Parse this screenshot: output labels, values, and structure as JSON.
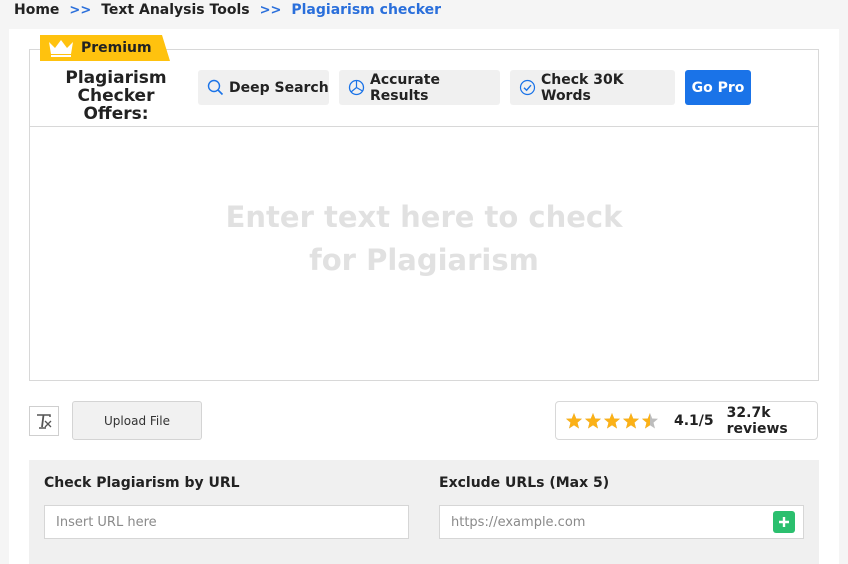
{
  "breadcrumb": {
    "items": [
      "Home",
      "Text Analysis Tools"
    ],
    "separator": ">>",
    "current": "Plagiarism checker"
  },
  "premium": {
    "badge_label": "Premium",
    "offers_title_line1": "Plagiarism",
    "offers_title_line2": "Checker Offers:",
    "features": [
      {
        "label": "Deep Search",
        "icon": "search-icon"
      },
      {
        "label": "Accurate Results",
        "icon": "pie-chart-icon"
      },
      {
        "label": "Check 30K Words",
        "icon": "check-circle-icon"
      }
    ],
    "go_pro_label": "Go Pro"
  },
  "editor": {
    "placeholder_line1": "Enter text here to check",
    "placeholder_line2": "for Plagiarism"
  },
  "toolbar": {
    "clear_icon": "clear-format-icon",
    "upload_label": "Upload File"
  },
  "rating": {
    "stars": 4.1,
    "value_text": "4.1/5",
    "reviews_text": "32.7k reviews"
  },
  "url_check": {
    "check_label": "Check Plagiarism by URL",
    "check_placeholder": "Insert URL here",
    "exclude_label": "Exclude URLs (Max 5)",
    "exclude_placeholder": "https://example.com",
    "add_icon": "plus-icon"
  },
  "colors": {
    "accent": "#1a73e8",
    "premium": "#ffc20e",
    "star": "#fbb117",
    "add": "#2bbf6e"
  }
}
